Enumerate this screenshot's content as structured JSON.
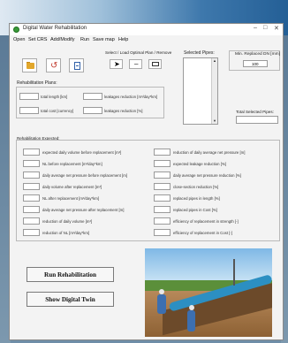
{
  "window": {
    "title": "Digital Water Rehabilitation",
    "controls": {
      "minimize": "–",
      "maximize": "□",
      "close": "✕"
    }
  },
  "menu": [
    "Open",
    "Set CRS",
    "Add/Modify",
    "Run",
    "Save map",
    "Help"
  ],
  "toolbar_icons": [
    "folder-open-icon",
    "undo-icon",
    "document-icon"
  ],
  "select_load": {
    "label": "Select / Load Optimal Plan / Remove",
    "icons": [
      "pointer-icon",
      "minus-icon",
      "erase-icon"
    ]
  },
  "selected_pipes": {
    "label": "Selected Pipes:"
  },
  "min_replaced_dn": {
    "label": "Min. Replaced DN [mm]",
    "value": "100"
  },
  "total_selected_pipes": {
    "label": "Total Selected Pipes:"
  },
  "rehab_plans": {
    "title": "Rehabilitation Plans:",
    "fields": [
      "total length [km]",
      "leakages reduction [m³/day*km]",
      "total cost [currency]",
      "leakages reduction [%]"
    ]
  },
  "rehab_expected": {
    "title": "Rehabilitation Expected:",
    "left": [
      "expected daily volume before replacement [m³]",
      "NL before replacement [m³/day*km]",
      "daily average net pressure before replacement [m]",
      "daily volume after replacement [m³]",
      "NL after replacement [m³/day*km]",
      "daily average net pressure after replacement [m]",
      "reduction of daily volume [m³]",
      "reduction of NL [m³/day*km]"
    ],
    "right": [
      "reduction of daily average net pressure [m]",
      "expected leakage reduction [%]",
      "daily average net pressure reduction [%]",
      "close-section reduction [%]",
      "replaced pipes in length [%]",
      "replaced pipes in Cost [%]",
      "efficiency of replacement in strength [-]",
      "efficiency of replacement in Cost [-]"
    ]
  },
  "buttons": {
    "run_rehab": "Run Rehabilitation",
    "show_twin": "Show Digital Twin"
  }
}
